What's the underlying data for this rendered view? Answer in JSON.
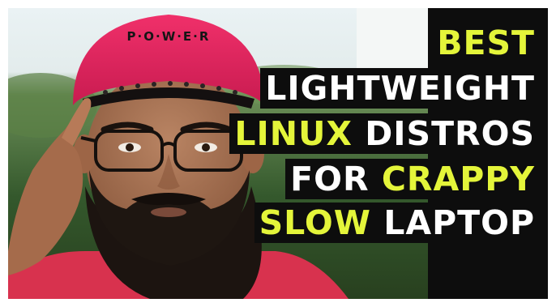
{
  "cap_text": "P·O·W·E·R",
  "title": {
    "line1": [
      {
        "text": "BEST",
        "hl": true
      }
    ],
    "line2": [
      {
        "text": "LIGHTWEIGHT",
        "hl": false
      }
    ],
    "line3": [
      {
        "text": "LINUX",
        "hl": true
      },
      {
        "text": " DISTROS",
        "hl": false
      }
    ],
    "line4": [
      {
        "text": "FOR ",
        "hl": false
      },
      {
        "text": "CRAPPY",
        "hl": true
      }
    ],
    "line5": [
      {
        "text": "SLOW",
        "hl": true
      },
      {
        "text": " LAPTOP",
        "hl": false
      }
    ]
  },
  "colors": {
    "highlight": "#e4f53a",
    "text": "#ffffff",
    "panel": "#0d0d0d",
    "cap": "#e8265a"
  }
}
